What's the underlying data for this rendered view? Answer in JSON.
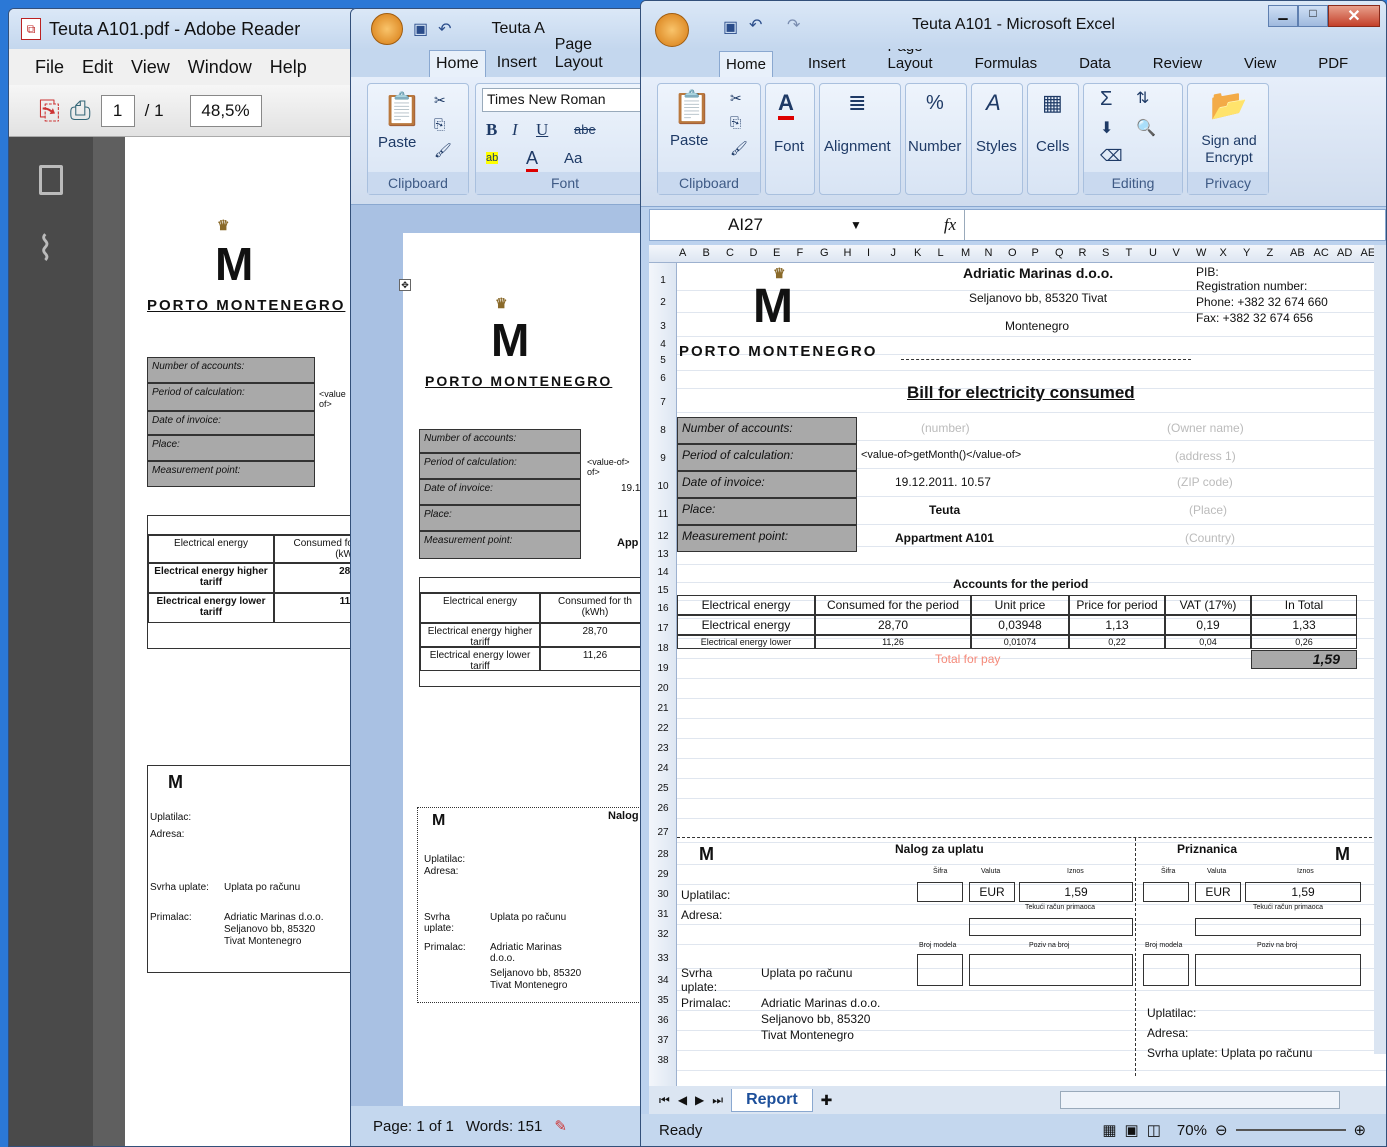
{
  "adobe": {
    "title": "Teuta A101.pdf - Adobe Reader",
    "menu": [
      "File",
      "Edit",
      "View",
      "Window",
      "Help"
    ],
    "page_current": "1",
    "page_total": "/ 1",
    "zoom": "48,5%",
    "doc": {
      "company": "PORTO MONTENEGRO",
      "rows": [
        "Number of accounts:",
        "Period of calculation:",
        "Date of invoice:",
        "Place:",
        "Measurement point:"
      ],
      "period_value": "<value of>",
      "table_head": [
        "Electrical energy",
        "Consumed fo (kW"
      ],
      "table_rows": [
        [
          "Electrical energy higher tariff",
          "28,"
        ],
        [
          "Electrical energy lower tariff",
          "11,"
        ]
      ],
      "slip": {
        "payer": "Uplatilac:",
        "address": "Adresa:",
        "purpose_label": "Svrha uplate:",
        "purpose": "Uplata po računu",
        "recipient_label": "Primalac:",
        "recipient": [
          "Adriatic Marinas d.o.o.",
          "Seljanovo bb, 85320",
          "Tivat Montenegro"
        ]
      }
    }
  },
  "word": {
    "title": "Teuta A",
    "tabs": [
      "Home",
      "Insert",
      "Page Layout"
    ],
    "font": "Times New Roman",
    "groups": {
      "clipboard": "Clipboard",
      "font": "Font",
      "paste": "Paste"
    },
    "doc": {
      "company": "PORTO MONTENEGRO",
      "rows": [
        "Number of accounts:",
        "Period of calculation:",
        "Date of invoice:",
        "Place:",
        "Measurement point:"
      ],
      "period_value": "<value-of> of>",
      "date_value": "19.1",
      "mp_value": "App",
      "table_head": [
        "Electrical energy",
        "Consumed for th (kWh)"
      ],
      "table_rows": [
        [
          "Electrical energy higher tariff",
          "28,70"
        ],
        [
          "Electrical energy lower tariff",
          "11,26"
        ]
      ],
      "slip": {
        "header": "Nalog",
        "payer": "Uplatilac:",
        "address": "Adresa:",
        "purpose_label": "Svrha uplate:",
        "purpose": "Uplata po računu",
        "recipient_label": "Primalac:",
        "recipient": [
          "Adriatic Marinas d.o.o.",
          "Seljanovo bb, 85320",
          "Tivat Montenegro"
        ]
      }
    },
    "status": {
      "page": "Page: 1 of 1",
      "words": "Words: 151"
    }
  },
  "excel": {
    "title": "Teuta A101 - Microsoft Excel",
    "tabs": [
      "Home",
      "Insert",
      "Page Layout",
      "Formulas",
      "Data",
      "Review",
      "View",
      "PDF"
    ],
    "groups": {
      "clipboard": "Clipboard",
      "font": "Font",
      "alignment": "Alignment",
      "number": "Number",
      "styles": "Styles",
      "cells": "Cells",
      "editing": "Editing",
      "privacy": "Privacy",
      "paste": "Paste",
      "sign": "Sign and Encrypt"
    },
    "namebox": "AI27",
    "fx": "fx",
    "columns": [
      "A",
      "B",
      "C",
      "D",
      "E",
      "F",
      "G",
      "H",
      "I",
      "J",
      "K",
      "L",
      "M",
      "N",
      "O",
      "P",
      "Q",
      "R",
      "S",
      "T",
      "U",
      "V",
      "W",
      "X",
      "Y",
      "Z",
      "AB",
      "AC",
      "AD",
      "AE"
    ],
    "rows": [
      "1",
      "2",
      "3",
      "4",
      "5",
      "6",
      "7",
      "8",
      "9",
      "10",
      "11",
      "12",
      "13",
      "14",
      "15",
      "16",
      "17",
      "18",
      "19",
      "20",
      "21",
      "22",
      "23",
      "24",
      "25",
      "26",
      "27",
      "28",
      "29",
      "30",
      "31",
      "32",
      "33",
      "34",
      "35",
      "36",
      "37",
      "38"
    ],
    "sheet": {
      "company": "PORTO MONTENEGRO",
      "name": "Adriatic Marinas d.o.o.",
      "addr": "Seljanovo bb, 85320 Tivat",
      "country": "Montenegro",
      "pib": "PIB:",
      "reg": "Registration number:",
      "phone": "Phone: +382 32 674 660",
      "fax": "Fax: +382 32 674 656",
      "bill_title": "Bill for electricity consumed",
      "labels": [
        "Number of accounts:",
        "Period of calculation:",
        "Date of invoice:",
        "Place:",
        "Measurement point:"
      ],
      "values": [
        "(number)",
        "<value-of>getMonth()</value-of>",
        "19.12.2011. 10.57",
        "Teuta",
        "Appartment A101"
      ],
      "owner": [
        "(Owner name)",
        "(address 1)",
        "(ZIP code)",
        "(Place)",
        "(Country)"
      ],
      "accounts_title": "Accounts for the period",
      "table_head": [
        "Electrical energy",
        "Consumed for the period",
        "Unit price",
        "Price for period",
        "VAT (17%)",
        "In Total"
      ],
      "table_rows": [
        [
          "Electrical energy",
          "28,70",
          "0,03948",
          "1,13",
          "0,19",
          "1,33"
        ],
        [
          "Electrical energy lower",
          "11,26",
          "0,01074",
          "0,22",
          "0,04",
          "0,26"
        ]
      ],
      "total_label": "Total for pay",
      "total": "1,59",
      "slip": {
        "nalog": "Nalog za uplatu",
        "priznanica": "Priznanica",
        "sifra": "Šifra",
        "valuta": "Valuta",
        "iznos": "Iznos",
        "currency": "EUR",
        "amount": "1,59",
        "tekuci": "Tekući račun primaoca",
        "broj": "Broj modela",
        "poziv": "Poziv na broj",
        "payer": "Uplatilac:",
        "address": "Adresa:",
        "purpose_label": "Svrha uplate:",
        "purpose": "Uplata po računu",
        "recipient_label": "Primalac:",
        "recipient": [
          "Adriatic Marinas d.o.o.",
          "Seljanovo bb, 85320",
          "Tivat Montenegro"
        ],
        "receipt_purpose": "Svrha uplate: Uplata po računu"
      }
    },
    "sheet_tab": "Report",
    "status": {
      "ready": "Ready",
      "zoom": "70%"
    }
  }
}
